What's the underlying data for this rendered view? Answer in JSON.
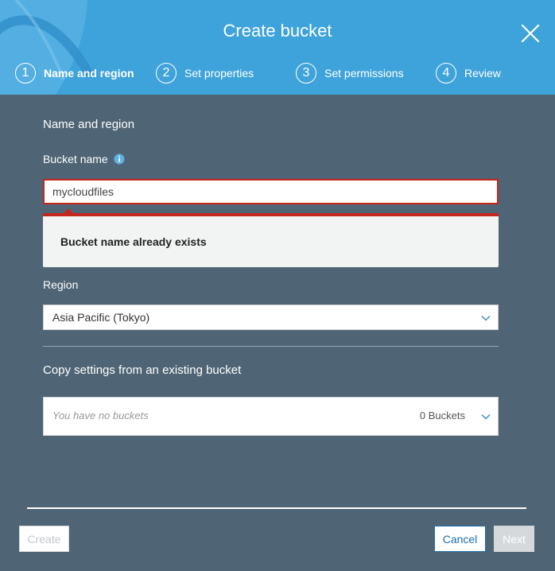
{
  "dialog": {
    "title": "Create bucket"
  },
  "steps": [
    {
      "number": "1",
      "label": "Name and region",
      "active": true
    },
    {
      "number": "2",
      "label": "Set properties",
      "active": false
    },
    {
      "number": "3",
      "label": "Set permissions",
      "active": false
    },
    {
      "number": "4",
      "label": "Review",
      "active": false
    }
  ],
  "name_region": {
    "section_title": "Name and region",
    "bucket_name_label": "Bucket name",
    "bucket_name_value": "mycloudfiles",
    "error_message": "Bucket name already exists",
    "region_label": "Region",
    "region_value": "Asia Pacific (Tokyo)"
  },
  "copy_settings": {
    "title": "Copy settings from an existing bucket",
    "placeholder": "You have no buckets",
    "count": "0 Buckets"
  },
  "footer": {
    "create_label": "Create",
    "cancel_label": "Cancel",
    "next_label": "Next"
  },
  "colors": {
    "header": "#3fa3db",
    "body": "#4f6575",
    "error": "#c4261d",
    "link": "#1b6fb2"
  },
  "icons": [
    "close-icon",
    "info-icon",
    "chevron-down-icon"
  ]
}
